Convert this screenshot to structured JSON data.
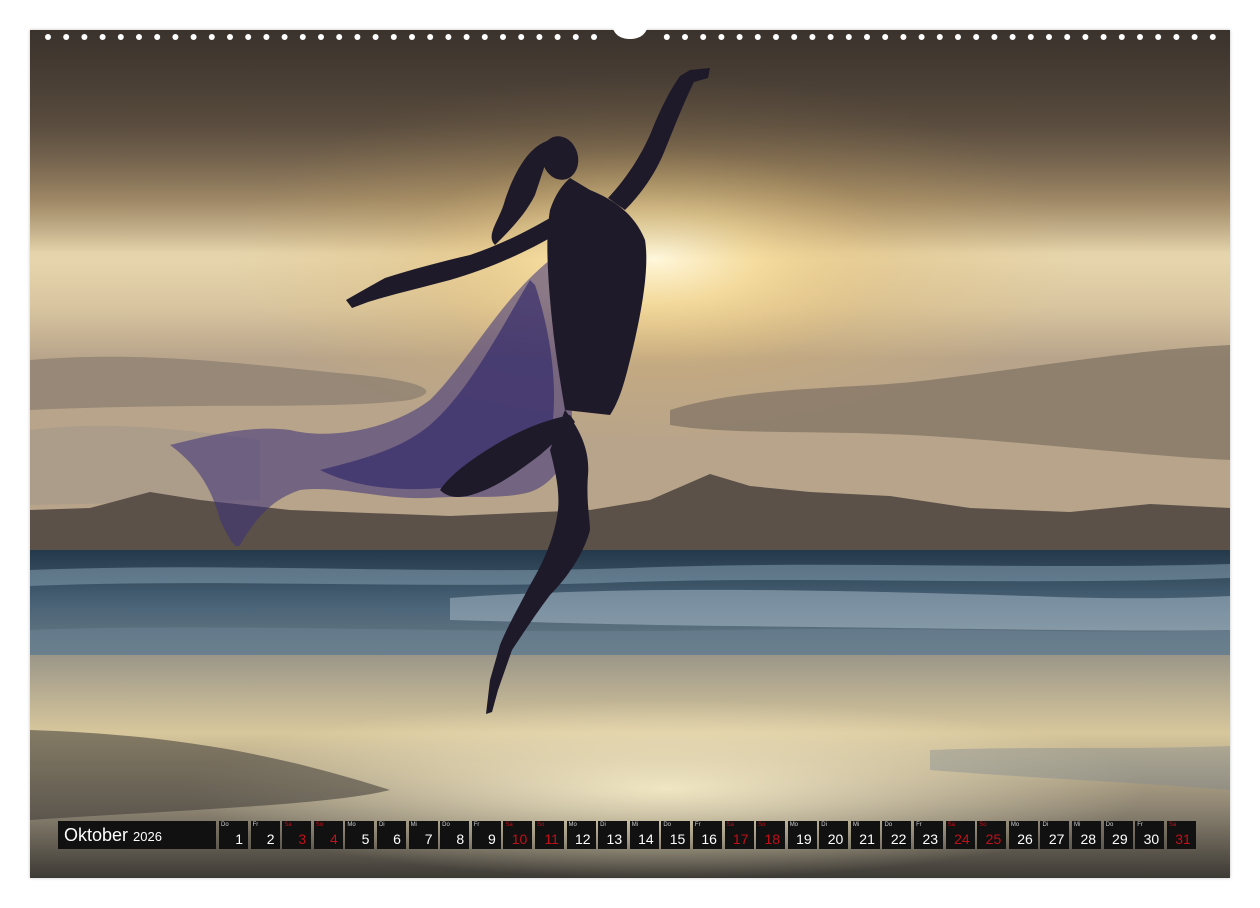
{
  "calendar": {
    "month": "Oktober",
    "year": "2026",
    "days": [
      {
        "wd": "Do",
        "n": "1",
        "weekend": false
      },
      {
        "wd": "Fr",
        "n": "2",
        "weekend": false
      },
      {
        "wd": "Sa",
        "n": "3",
        "weekend": true
      },
      {
        "wd": "So",
        "n": "4",
        "weekend": true
      },
      {
        "wd": "Mo",
        "n": "5",
        "weekend": false
      },
      {
        "wd": "Di",
        "n": "6",
        "weekend": false
      },
      {
        "wd": "Mi",
        "n": "7",
        "weekend": false
      },
      {
        "wd": "Do",
        "n": "8",
        "weekend": false
      },
      {
        "wd": "Fr",
        "n": "9",
        "weekend": false
      },
      {
        "wd": "Sa",
        "n": "10",
        "weekend": true
      },
      {
        "wd": "So",
        "n": "11",
        "weekend": true
      },
      {
        "wd": "Mo",
        "n": "12",
        "weekend": false
      },
      {
        "wd": "Di",
        "n": "13",
        "weekend": false
      },
      {
        "wd": "Mi",
        "n": "14",
        "weekend": false
      },
      {
        "wd": "Do",
        "n": "15",
        "weekend": false
      },
      {
        "wd": "Fr",
        "n": "16",
        "weekend": false
      },
      {
        "wd": "Sa",
        "n": "17",
        "weekend": true
      },
      {
        "wd": "So",
        "n": "18",
        "weekend": true
      },
      {
        "wd": "Mo",
        "n": "19",
        "weekend": false
      },
      {
        "wd": "Di",
        "n": "20",
        "weekend": false
      },
      {
        "wd": "Mi",
        "n": "21",
        "weekend": false
      },
      {
        "wd": "Do",
        "n": "22",
        "weekend": false
      },
      {
        "wd": "Fr",
        "n": "23",
        "weekend": false
      },
      {
        "wd": "Sa",
        "n": "24",
        "weekend": true
      },
      {
        "wd": "So",
        "n": "25",
        "weekend": true
      },
      {
        "wd": "Mo",
        "n": "26",
        "weekend": false
      },
      {
        "wd": "Di",
        "n": "27",
        "weekend": false
      },
      {
        "wd": "Mi",
        "n": "28",
        "weekend": false
      },
      {
        "wd": "Do",
        "n": "29",
        "weekend": false
      },
      {
        "wd": "Fr",
        "n": "30",
        "weekend": false
      },
      {
        "wd": "Sa",
        "n": "31",
        "weekend": true
      }
    ]
  },
  "colors": {
    "strip_background": "#111111",
    "weekday_text": "#ffffff",
    "weekend_text": "#c0101a",
    "sky_top": "#4a4038",
    "sun_glow": "#fff3c8",
    "sea": "#2e4a5e",
    "silhouette": "#1e1a2a",
    "fabric": "#3b2f7a"
  },
  "photo": {
    "subject_icon": "dancer-silhouette-icon"
  }
}
